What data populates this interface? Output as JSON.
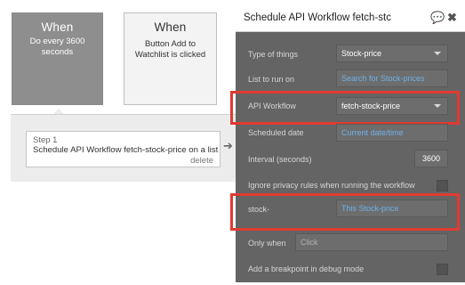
{
  "events": [
    {
      "title": "When",
      "subtitle": "Do every 3600 seconds"
    },
    {
      "title": "When",
      "subtitle": "Button Add to Watchlist is clicked"
    }
  ],
  "step": {
    "number": "Step 1",
    "title": "Schedule API Workflow fetch-stock-price on a list",
    "delete": "delete",
    "arrow_glyph": "➔"
  },
  "panel": {
    "title": "Schedule API Workflow fetch-stc",
    "icons": {
      "comment": "comment-icon",
      "close": "close-icon",
      "comment_glyph": "💬",
      "close_glyph": "✖"
    },
    "type_of_things": {
      "label": "Type of things",
      "value": "Stock-price"
    },
    "list_to_run_on": {
      "label": "List to run on",
      "value": "Search for Stock-prices"
    },
    "api_workflow": {
      "label": "API Workflow",
      "value": "fetch-stock-price"
    },
    "scheduled_date": {
      "label": "Scheduled date",
      "value": "Current date/time"
    },
    "interval": {
      "label": "Interval (seconds)",
      "value": "3600"
    },
    "ignore_privacy": {
      "label": "Ignore privacy rules when running the workflow"
    },
    "param": {
      "label": "stock-",
      "value": "This Stock-price"
    },
    "only_when": {
      "label": "Only when",
      "placeholder": "Click"
    },
    "breakpoint": {
      "label": "Add a breakpoint in debug mode"
    }
  },
  "colors": {
    "highlight": "#e03a30",
    "panel_bg": "#646464",
    "link_blue": "#6fb1e8",
    "selected_event": "#8e8e8e"
  }
}
